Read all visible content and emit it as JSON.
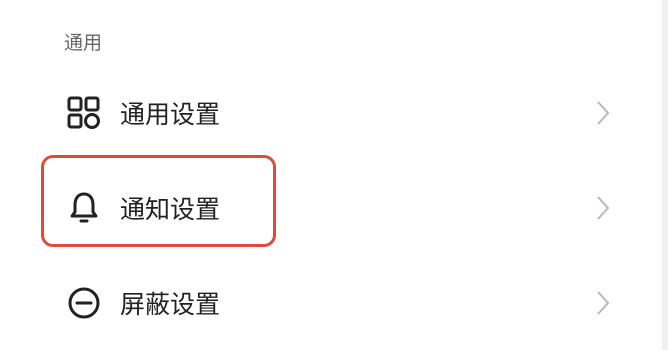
{
  "section": {
    "title": "通用"
  },
  "rows": [
    {
      "label": "通用设置",
      "icon": "grid-apps-icon",
      "chevron": "chevron-right-icon"
    },
    {
      "label": "通知设置",
      "icon": "bell-icon",
      "chevron": "chevron-right-icon"
    },
    {
      "label": "屏蔽设置",
      "icon": "block-minus-circle-icon",
      "chevron": "chevron-right-icon"
    }
  ],
  "colors": {
    "highlight": "#e04a3a",
    "chevron": "#b8b8b8",
    "icon": "#222222"
  }
}
